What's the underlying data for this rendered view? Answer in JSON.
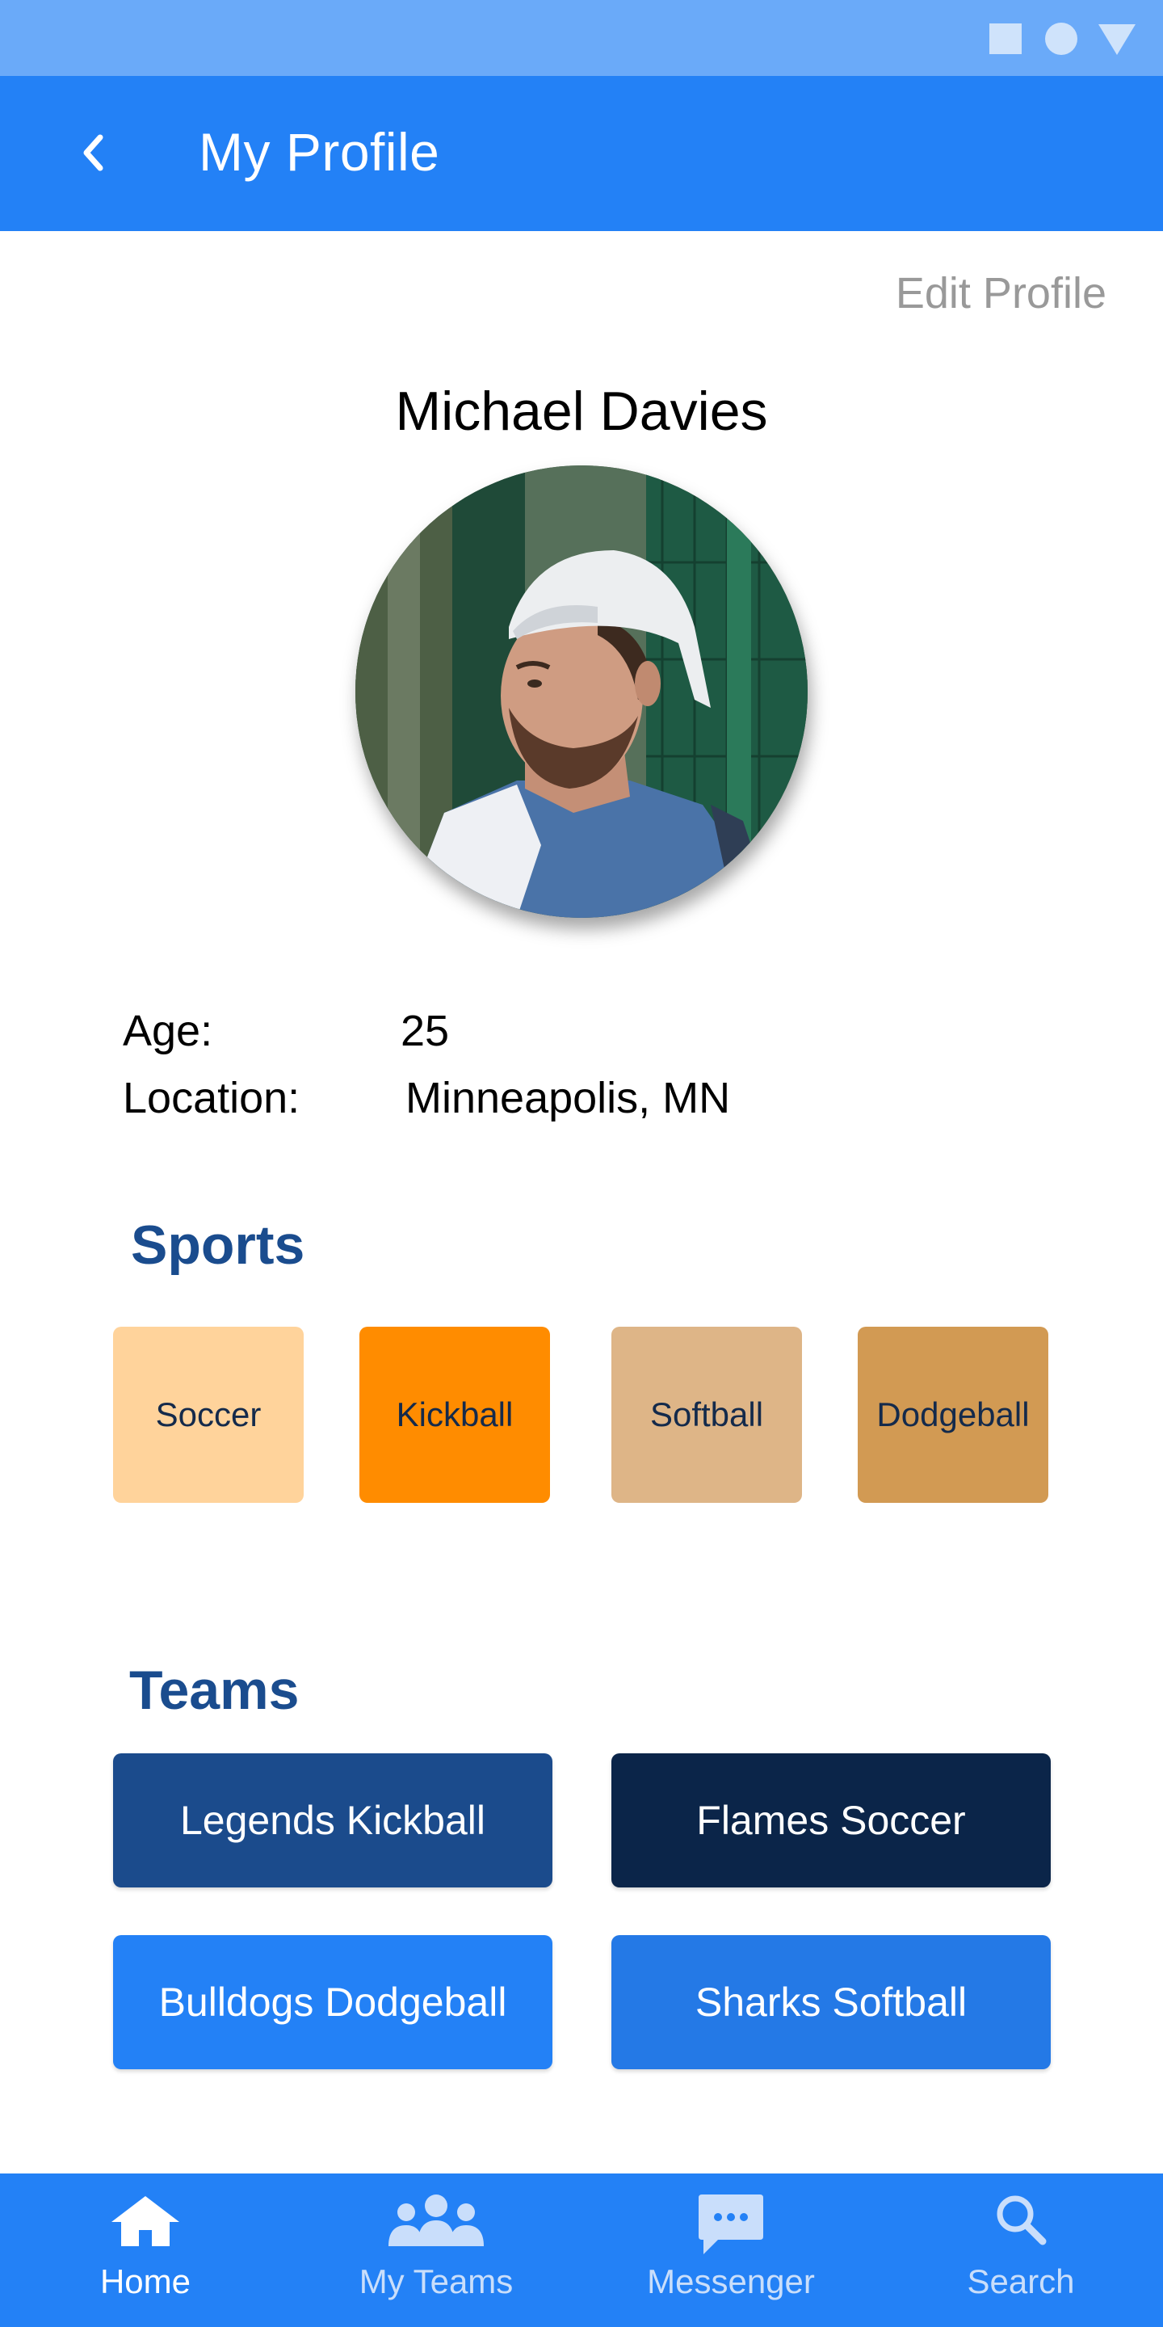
{
  "header": {
    "title": "My Profile",
    "back_icon": "chevron-left-icon"
  },
  "profile": {
    "edit_label": "Edit Profile",
    "name": "Michael Davies",
    "age_label": "Age:",
    "age_value": "25",
    "location_label": "Location:",
    "location_value": "Minneapolis, MN"
  },
  "sports": {
    "title": "Sports",
    "items": [
      {
        "label": "Soccer",
        "color": "#ffd39b"
      },
      {
        "label": "Kickball",
        "color": "#ff8c00"
      },
      {
        "label": "Softball",
        "color": "#deb587"
      },
      {
        "label": "Dodgeball",
        "color": "#d29a53"
      }
    ]
  },
  "teams": {
    "title": "Teams",
    "items": [
      {
        "label": "Legends Kickball",
        "color": "#1b4b8c"
      },
      {
        "label": "Flames Soccer",
        "color": "#0b2549"
      },
      {
        "label": "Bulldogs Dodgeball",
        "color": "#2381f6"
      },
      {
        "label": "Sharks Softball",
        "color": "#2479e6"
      }
    ]
  },
  "nav": {
    "items": [
      {
        "label": "Home",
        "icon": "home-icon",
        "active": true
      },
      {
        "label": "My Teams",
        "icon": "group-icon",
        "active": false
      },
      {
        "label": "Messenger",
        "icon": "chat-icon",
        "active": false
      },
      {
        "label": "Search",
        "icon": "search-icon",
        "active": false
      }
    ]
  },
  "colors": {
    "primary": "#2381f6",
    "status_bar": "#6aaaf9",
    "section_title": "#1a4c8e"
  }
}
